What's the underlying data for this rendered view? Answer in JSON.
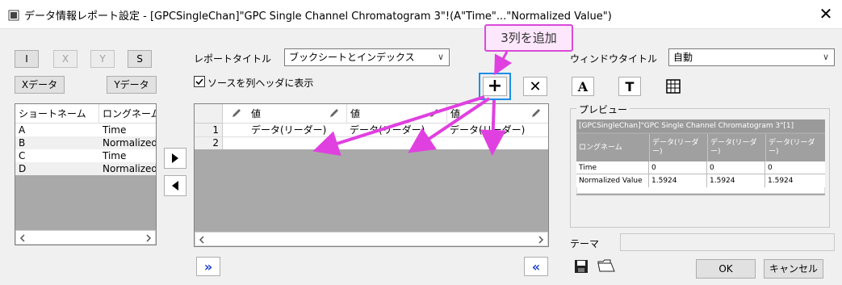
{
  "window": {
    "title": "データ情報レポート設定 - [GPCSingleChan]\"GPC Single Channel Chromatogram 3\"!(A\"Time\"...\"Normalized Value\")",
    "close_label": "✕"
  },
  "left_panel": {
    "letter_buttons": [
      "I",
      "X",
      "Y",
      "S"
    ],
    "xdata_button": "Xデータ",
    "ydata_button": "Yデータ",
    "columns": [
      "ショートネーム",
      "ロングネーム"
    ],
    "rows": [
      [
        "A",
        "Time"
      ],
      [
        "B",
        "Normalized Value"
      ],
      [
        "C",
        "Time"
      ],
      [
        "D",
        "Normalized Value"
      ]
    ]
  },
  "mid": {
    "report_title_label": "レポートタイトル",
    "report_title_value": "ブックシートとインデックス",
    "show_source_checkbox": "ソースを列ヘッダに表示",
    "add_button": "+",
    "delete_button": "✕",
    "table": {
      "headers": [
        "値",
        "値",
        "値"
      ],
      "row_numbers": [
        "1",
        "2"
      ],
      "row1": [
        "データ(リーダー)",
        "データ(リーダー)",
        "データ(リーダー)"
      ]
    },
    "expand_button": "»",
    "collapse_button": "«"
  },
  "right_panel": {
    "window_title_label": "ウィンドウタイトル",
    "window_title_value": "自動",
    "preview_label": "プレビュー",
    "preview": {
      "title": "[GPCSingleChan]\"GPC Single Channel Chromatogram 3\"[1]",
      "header": [
        "ロングネーム",
        "データ(リーダー)",
        "データ(リーダー)",
        "データ(リーダー)"
      ],
      "rows": [
        [
          "Time",
          "0",
          "0",
          "0"
        ],
        [
          "Normalized Value",
          "1.5924",
          "1.5924",
          "1.5924"
        ]
      ]
    },
    "theme_label": "テーマ",
    "ok_button": "OK",
    "cancel_button": "キャンセル"
  },
  "annotation": {
    "callout": "3列を追加",
    "color": "#e040e0"
  }
}
